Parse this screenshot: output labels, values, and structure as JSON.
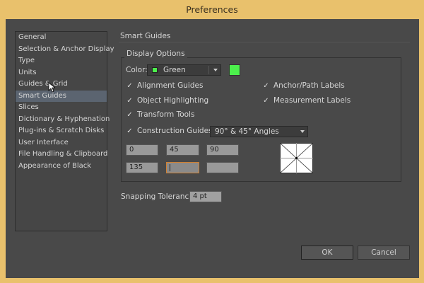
{
  "window": {
    "title": "Preferences"
  },
  "sidebar": {
    "items": [
      {
        "label": "General"
      },
      {
        "label": "Selection & Anchor Display"
      },
      {
        "label": "Type"
      },
      {
        "label": "Units"
      },
      {
        "label": "Guides & Grid"
      },
      {
        "label": "Smart Guides",
        "selected": true
      },
      {
        "label": "Slices"
      },
      {
        "label": "Dictionary & Hyphenation"
      },
      {
        "label": "Plug-ins & Scratch Disks"
      },
      {
        "label": "User Interface"
      },
      {
        "label": "File Handling & Clipboard"
      },
      {
        "label": "Appearance of Black"
      }
    ]
  },
  "section": {
    "title": "Smart Guides",
    "group_label": "Display Options",
    "color_label": "Color:",
    "color_value": "Green",
    "color_hex": "#4cf04c",
    "checks": {
      "alignment": "Alignment Guides",
      "object": "Object Highlighting",
      "transform": "Transform Tools",
      "anchor": "Anchor/Path Labels",
      "measurement": "Measurement Labels",
      "construction": "Construction Guides:"
    },
    "construction_value": "90° & 45° Angles",
    "angles": [
      "0",
      "45",
      "90",
      "135",
      "",
      ""
    ],
    "snapping_label": "Snapping Tolerance:",
    "snapping_value": "4 pt"
  },
  "buttons": {
    "ok": "OK",
    "cancel": "Cancel"
  }
}
